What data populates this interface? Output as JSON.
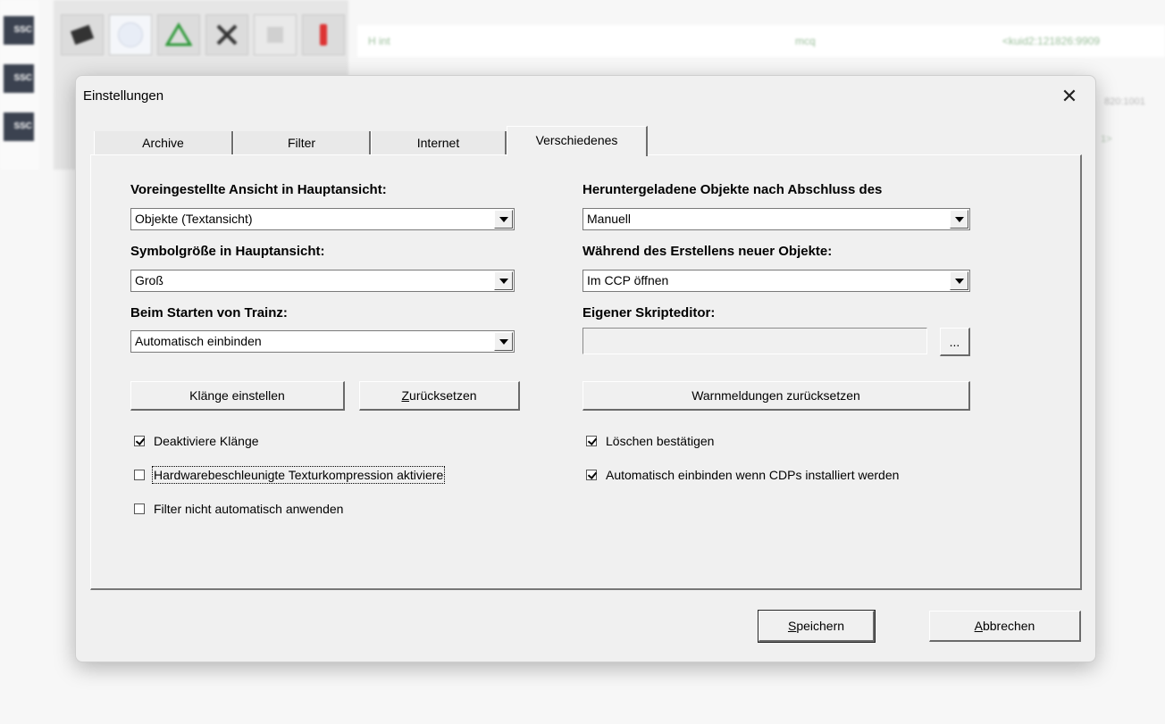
{
  "background": {
    "badges": [
      "SSC",
      "SSC",
      "SSC"
    ],
    "row": {
      "name": "H int",
      "author": "mcq",
      "kuid": "<kuid2:121826:9909"
    },
    "kuid_fragments": [
      "820:1001",
      "1>"
    ]
  },
  "dialog": {
    "title": "Einstellungen",
    "tabs": [
      "Archive",
      "Filter",
      "Internet",
      "Verschiedenes"
    ],
    "active_tab": "Verschiedenes",
    "left": {
      "view_label": "Voreingestellte Ansicht in Hauptansicht:",
      "view_value": "Objekte (Textansicht)",
      "icon_size_label": "Symbolgröße in Hauptansicht:",
      "icon_size_value": "Groß",
      "startup_label": "Beim Starten von Trainz:",
      "startup_value": "Automatisch einbinden",
      "sounds_button": "Klänge einstellen",
      "reset_button": "Zurücksetzen",
      "disable_sounds": "Deaktiviere Klänge",
      "hw_compression": "Hardwarebeschleunigte Texturkompression aktiviere",
      "no_auto_filter": "Filter nicht automatisch anwenden"
    },
    "right": {
      "downloaded_label": "Heruntergeladene Objekte nach Abschluss des",
      "downloaded_value": "Manuell",
      "creating_label": "Während des Erstellens neuer Objekte:",
      "creating_value": "Im CCP öffnen",
      "script_editor_label": "Eigener Skripteditor:",
      "script_editor_value": "",
      "browse_button": "...",
      "reset_warnings_button": "Warnmeldungen zurücksetzen",
      "confirm_delete": "Löschen bestätigen",
      "auto_install_cdp": "Automatisch einbinden wenn CDPs installiert werden"
    },
    "checked": {
      "disable_sounds": true,
      "hw_compression": false,
      "no_auto_filter": false,
      "confirm_delete": true,
      "auto_install_cdp": true
    },
    "save_button": "Speichern",
    "cancel_button": "Abbrechen"
  }
}
